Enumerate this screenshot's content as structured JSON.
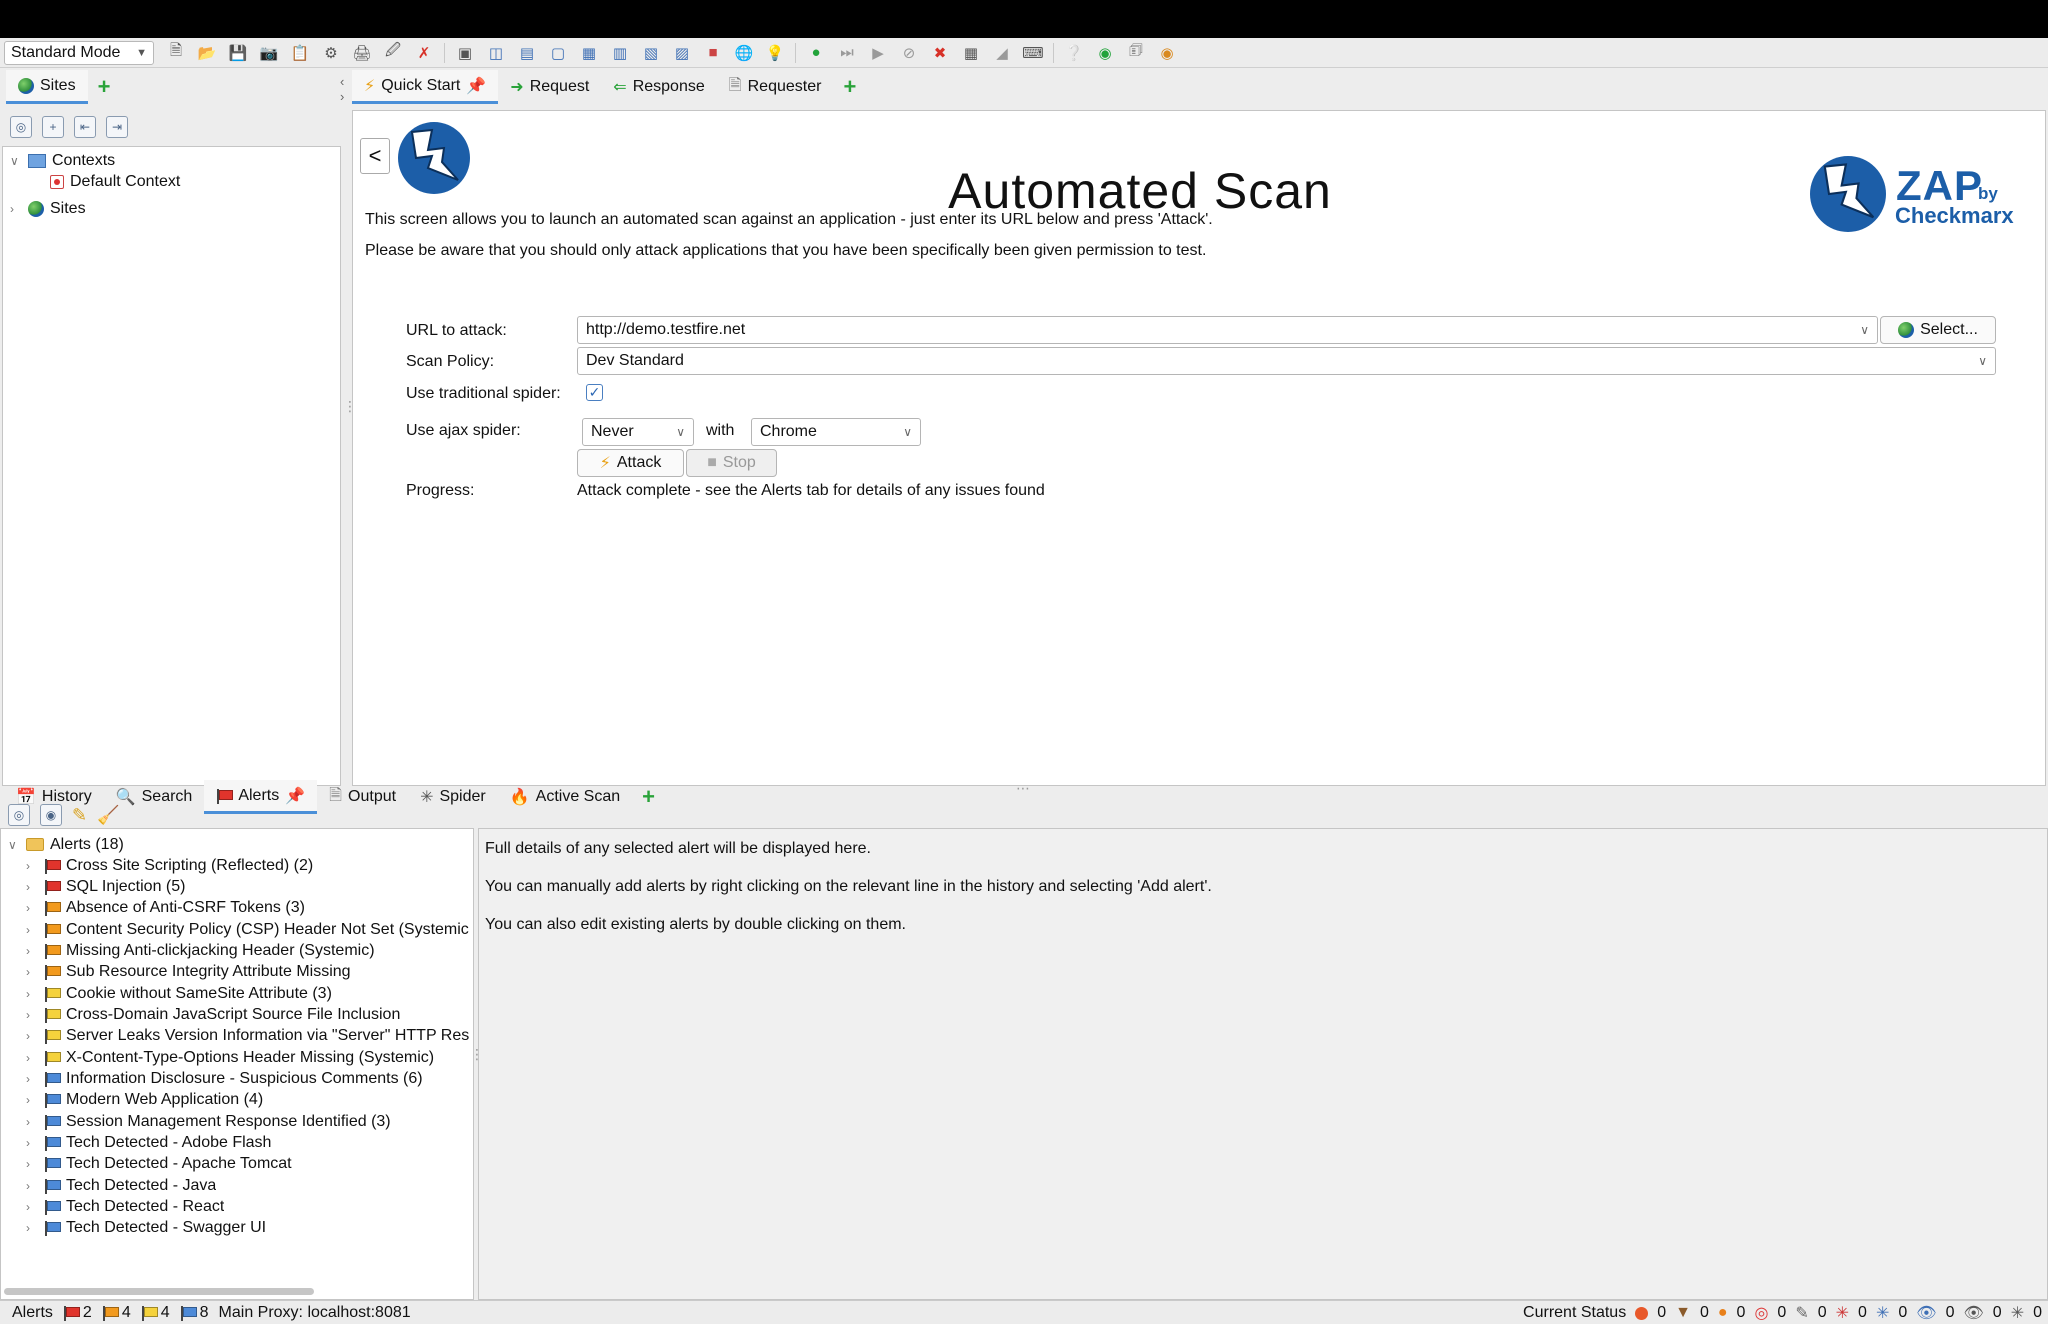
{
  "toolbar": {
    "mode": "Standard Mode"
  },
  "sites_panel": {
    "tab": "Sites",
    "tree": {
      "contexts": "Contexts",
      "default_context": "Default Context",
      "sites": "Sites"
    }
  },
  "workspace": {
    "tabs": [
      "Quick Start",
      "Request",
      "Response",
      "Requester"
    ]
  },
  "quick_start": {
    "back_label": "<",
    "title": "Automated Scan",
    "brand": {
      "zap": "ZAP",
      "by": "by",
      "checkmarx": "Checkmarx"
    },
    "intro_1": "This screen allows you to launch an automated scan against  an application - just enter its URL below and press 'Attack'.",
    "intro_2": "Please be aware that you should only attack applications that you have been specifically been given permission to test.",
    "url_label": "URL to attack:",
    "url_value": "http://demo.testfire.net",
    "select_button": "Select...",
    "policy_label": "Scan Policy:",
    "policy_value": "Dev Standard",
    "traditional_spider_label": "Use traditional spider:",
    "traditional_spider_checked": true,
    "ajax_spider_label": "Use ajax spider:",
    "ajax_spider_value": "Never",
    "with_label": "with",
    "browser_value": "Chrome",
    "attack_button": "Attack",
    "stop_button": "Stop",
    "progress_label": "Progress:",
    "progress_value": "Attack complete - see the Alerts tab for details of any issues found"
  },
  "bottom_tabs": [
    "History",
    "Search",
    "Alerts",
    "Output",
    "Spider",
    "Active Scan"
  ],
  "alerts": {
    "root": "Alerts (18)",
    "items": [
      {
        "label": "Cross Site Scripting (Reflected) (2)",
        "risk": "red"
      },
      {
        "label": "SQL Injection (5)",
        "risk": "red"
      },
      {
        "label": "Absence of Anti-CSRF Tokens (3)",
        "risk": "orange"
      },
      {
        "label": "Content Security Policy (CSP) Header Not Set (Systemic",
        "risk": "orange"
      },
      {
        "label": "Missing Anti-clickjacking Header (Systemic)",
        "risk": "orange"
      },
      {
        "label": "Sub Resource Integrity Attribute Missing",
        "risk": "orange"
      },
      {
        "label": "Cookie without SameSite Attribute (3)",
        "risk": "yellow"
      },
      {
        "label": "Cross-Domain JavaScript Source File Inclusion",
        "risk": "yellow"
      },
      {
        "label": "Server Leaks Version Information via \"Server\" HTTP Res",
        "risk": "yellow"
      },
      {
        "label": "X-Content-Type-Options Header Missing (Systemic)",
        "risk": "yellow"
      },
      {
        "label": "Information Disclosure - Suspicious Comments (6)",
        "risk": "blue"
      },
      {
        "label": "Modern Web Application (4)",
        "risk": "blue"
      },
      {
        "label": "Session Management Response Identified (3)",
        "risk": "blue"
      },
      {
        "label": "Tech Detected - Adobe Flash",
        "risk": "blue"
      },
      {
        "label": "Tech Detected - Apache Tomcat",
        "risk": "blue"
      },
      {
        "label": "Tech Detected - Java",
        "risk": "blue"
      },
      {
        "label": "Tech Detected - React",
        "risk": "blue"
      },
      {
        "label": "Tech Detected - Swagger UI",
        "risk": "blue"
      }
    ],
    "detail_1": "Full details of any selected alert will be displayed here.",
    "detail_2": "You can manually add alerts by right clicking on the relevant line in the history and selecting 'Add alert'.",
    "detail_3": "You can also edit existing alerts by double clicking on them."
  },
  "status": {
    "alerts_label": "Alerts",
    "high": "2",
    "medium": "4",
    "low": "4",
    "info": "8",
    "proxy": "Main Proxy: localhost:8081",
    "current_status": "Current Status",
    "counters": [
      "0",
      "0",
      "0",
      "0",
      "0",
      "0",
      "0",
      "0",
      "0",
      "0"
    ]
  },
  "colors": {
    "accent": "#4a8fd8",
    "brand_blue": "#1c5ea8",
    "flag_red": "#e0342c",
    "flag_orange": "#f29a1e",
    "flag_yellow": "#f5d23c",
    "flag_blue": "#4d8ad8"
  }
}
